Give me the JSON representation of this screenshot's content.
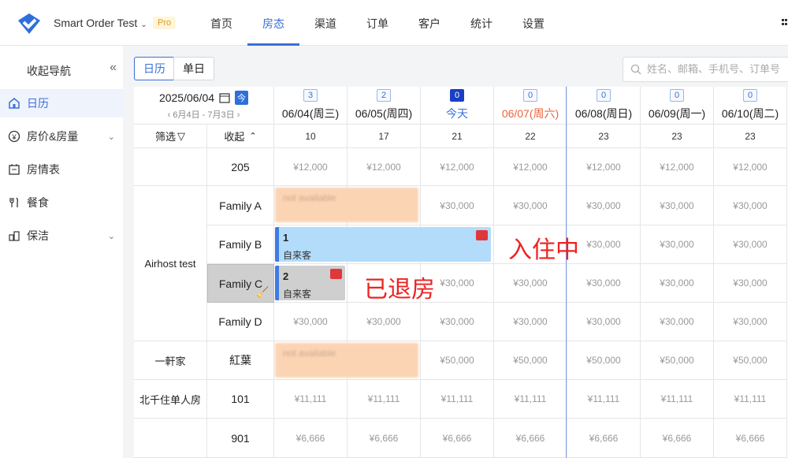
{
  "app": {
    "title": "Smart Order Test",
    "badge": "Pro"
  },
  "nav": [
    "首页",
    "房态",
    "渠道",
    "订单",
    "客户",
    "统计",
    "设置"
  ],
  "sidebar": {
    "header": "收起导航",
    "items": [
      {
        "label": "日历",
        "icon": "calendar-home-icon"
      },
      {
        "label": "房价&房量",
        "icon": "yen-icon"
      },
      {
        "label": "房情表",
        "icon": "table-icon"
      },
      {
        "label": "餐食",
        "icon": "fork-knife-icon"
      },
      {
        "label": "保洁",
        "icon": "cleaning-icon"
      }
    ]
  },
  "toolbar": {
    "tab_calendar": "日历",
    "tab_single": "单日",
    "search_placeholder": "姓名、邮箱、手机号、订单号"
  },
  "calendar": {
    "current_date": "2025/06/04",
    "range": "6月4日 - 7月3日",
    "today_btn": "今",
    "filter_label": "筛选",
    "collapse_label": "收起",
    "dates": [
      {
        "badge": "3",
        "label": "06/04(周三)",
        "count": "10"
      },
      {
        "badge": "2",
        "label": "06/05(周四)",
        "count": "17"
      },
      {
        "badge": "0",
        "label": "今天",
        "count": "21"
      },
      {
        "badge": "0",
        "label": "06/07(周六)",
        "count": "22"
      },
      {
        "badge": "0",
        "label": "06/08(周日)",
        "count": "23"
      },
      {
        "badge": "0",
        "label": "06/09(周一)",
        "count": "23"
      },
      {
        "badge": "0",
        "label": "06/10(周二)",
        "count": "23"
      }
    ],
    "rows": [
      {
        "group": "",
        "room": "205",
        "prices": [
          "¥12,000",
          "¥12,000",
          "¥12,000",
          "¥12,000",
          "¥12,000",
          "¥12,000",
          "¥12,000"
        ]
      },
      {
        "group": "Airhost test",
        "room": "Family A",
        "prices": [
          "",
          "",
          "¥30,000",
          "¥30,000",
          "¥30,000",
          "¥30,000",
          "¥30,000"
        ]
      },
      {
        "group": "",
        "room": "Family B",
        "prices": [
          "",
          "",
          "",
          "",
          "¥30,000",
          "¥30,000",
          "¥30,000"
        ]
      },
      {
        "group": "",
        "room": "Family C",
        "prices": [
          "",
          "",
          "¥30,000",
          "¥30,000",
          "¥30,000",
          "¥30,000",
          "¥30,000"
        ]
      },
      {
        "group": "",
        "room": "Family D",
        "prices": [
          "¥30,000",
          "¥30,000",
          "¥30,000",
          "¥30,000",
          "¥30,000",
          "¥30,000",
          "¥30,000"
        ]
      },
      {
        "group": "一軒家",
        "room": "紅葉",
        "prices": [
          "",
          "",
          "¥50,000",
          "¥50,000",
          "¥50,000",
          "¥50,000",
          "¥50,000"
        ]
      },
      {
        "group": "北千住单人房",
        "room": "101",
        "prices": [
          "¥11,111",
          "¥11,111",
          "¥11,111",
          "¥11,111",
          "¥11,111",
          "¥11,111",
          "¥11,111"
        ]
      },
      {
        "group": "",
        "room": "901",
        "prices": [
          "¥6,666",
          "¥6,666",
          "¥6,666",
          "¥6,666",
          "¥6,666",
          "¥6,666",
          "¥6,666"
        ]
      }
    ],
    "bookings": [
      {
        "num": "1",
        "guest": "自来客"
      },
      {
        "num": "2",
        "guest": "自来客"
      }
    ],
    "not_available": "not available",
    "annotations": {
      "checked_in": "入住中",
      "checked_out": "已退房"
    }
  }
}
